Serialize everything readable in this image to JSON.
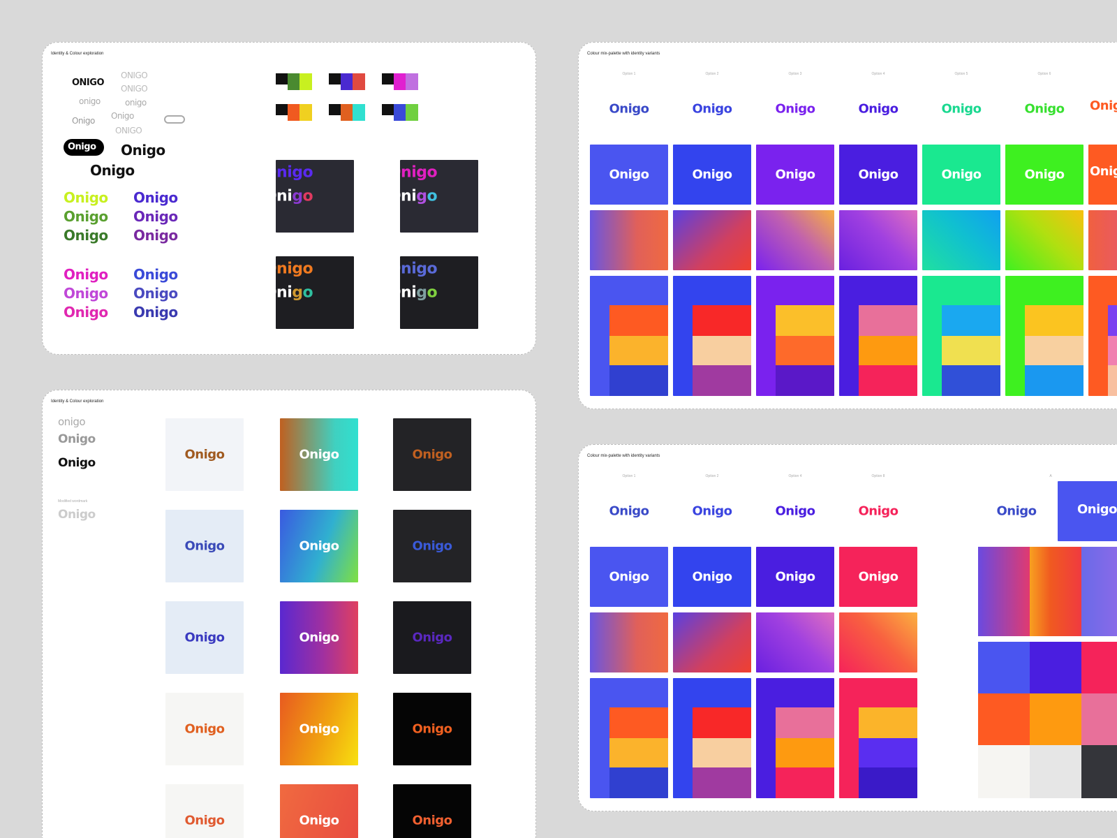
{
  "boards": {
    "board1_title": "Identity & Colour exploration",
    "board2_title": "Identity & Colour exploration",
    "board3_title": "Colour mix-palette with identity variants",
    "board4_title": "Colour mix-palette with identity variants"
  },
  "logo": {
    "word": "Onigo",
    "upper": "ONIGO",
    "lower": "onigo",
    "word_partial": "Oni",
    "word_g": "g",
    "word_o": "o"
  },
  "board2": {
    "modified_label": "Modified wordmark"
  },
  "board3": {
    "options": [
      "Option 1",
      "Option 2",
      "Option 3",
      "Option 4",
      "Option 5",
      "Option 6"
    ]
  },
  "board4": {
    "options": [
      "Option 1",
      "Option 2",
      "Option 4",
      "Option 8",
      "A"
    ]
  },
  "colors": {
    "blue": "#4a55f0",
    "royal": "#3344ee",
    "violet": "#7a22ee",
    "indigo": "#4a1ee0",
    "mint": "#1ae890",
    "lime": "#3ef020",
    "orange": "#fe5a22",
    "red": "#f5235a",
    "dark": "#26272e"
  }
}
